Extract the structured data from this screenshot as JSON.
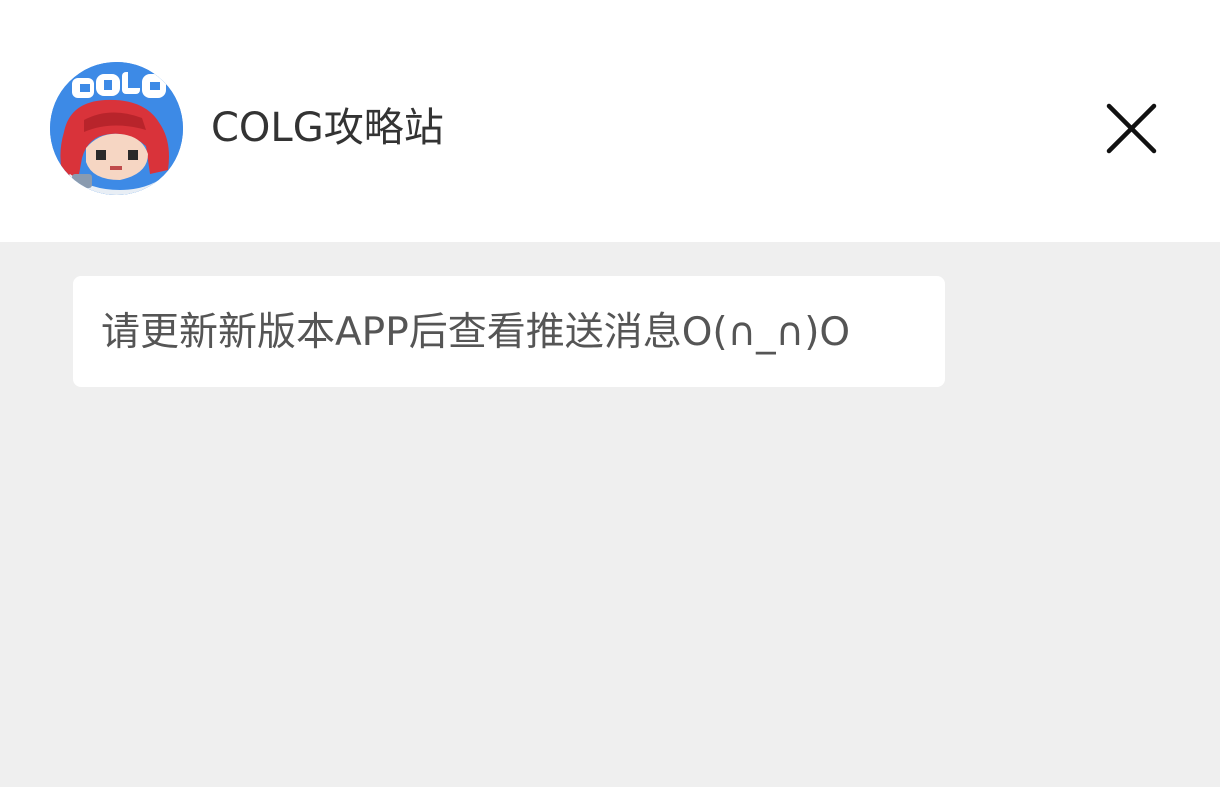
{
  "header": {
    "title": "COLG攻略站",
    "avatar_icon": "colg-logo-avatar",
    "close_icon": "close-icon"
  },
  "message": {
    "text": "请更新新版本APP后查看推送消息O(∩_∩)O"
  },
  "colors": {
    "header_bg": "#ffffff",
    "page_bg": "#efefef",
    "bubble_bg": "#ffffff",
    "title_color": "#333333",
    "message_color": "#555555",
    "avatar_bg": "#3d8ae6",
    "avatar_hair": "#d9333a"
  }
}
